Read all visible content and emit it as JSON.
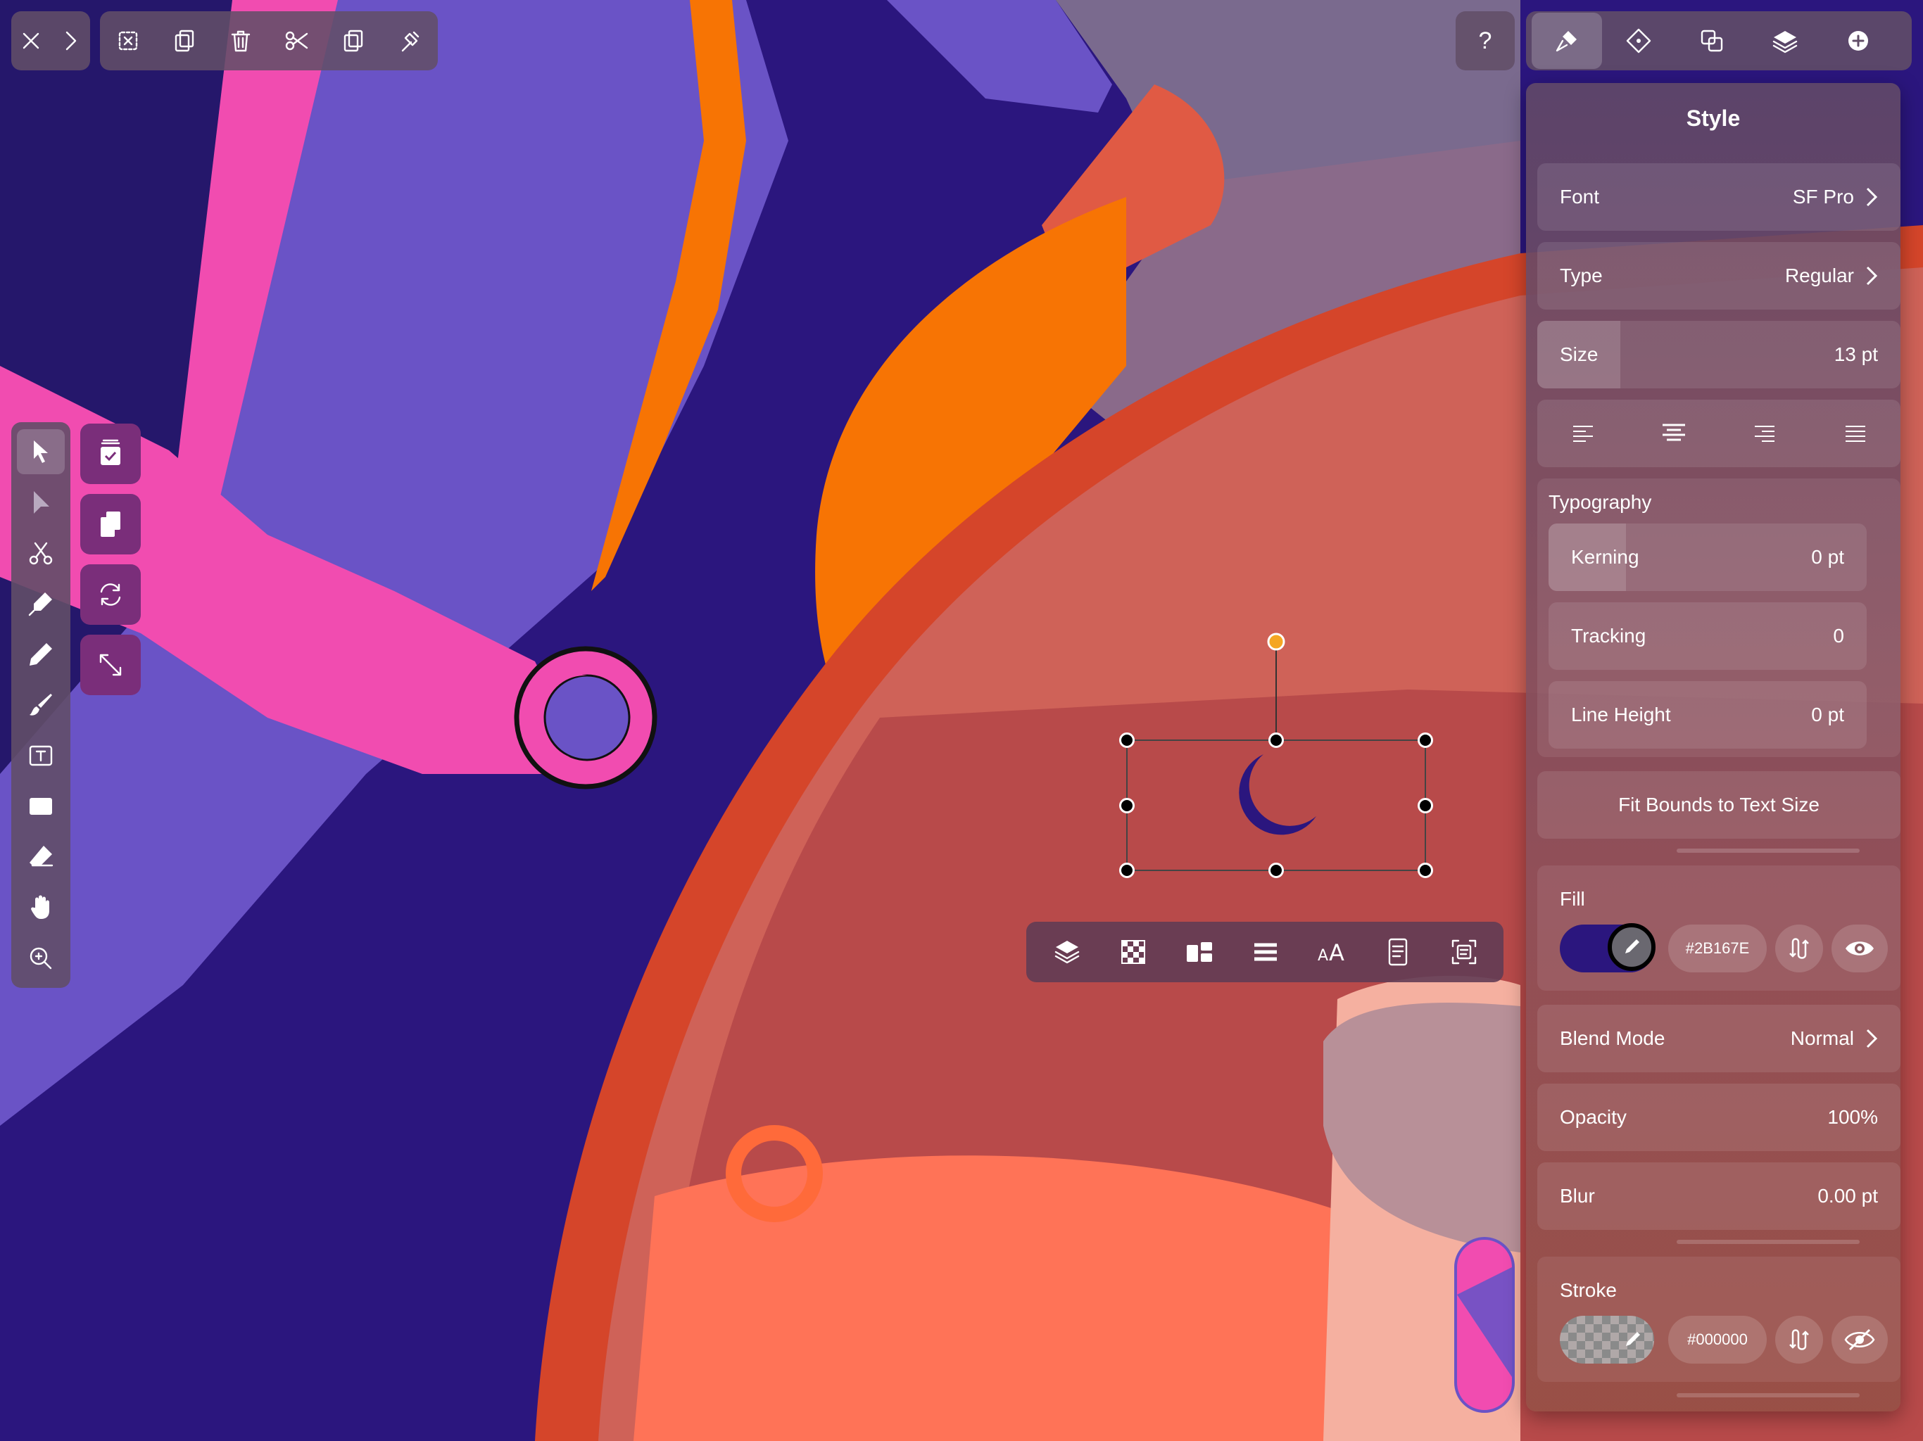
{
  "colors": {
    "accent_purple": "#2B167E",
    "pink": "#F14CB0",
    "orange": "#F77404",
    "violet": "#6A53C6"
  },
  "top_toolbar": {
    "left_group": [
      "close-icon",
      "chevron-right-icon"
    ],
    "edit_group": [
      "deselect-icon",
      "duplicate-icon",
      "trash-icon",
      "scissors-icon",
      "copy-icon",
      "paste-style-icon"
    ],
    "help_label": "?",
    "panel_tabs": [
      "style-brush-icon",
      "diamond-icon",
      "boolean-icon",
      "layers-icon",
      "plus-circle-icon"
    ]
  },
  "style_panel": {
    "title": "Style",
    "font": {
      "label": "Font",
      "value": "SF Pro"
    },
    "type": {
      "label": "Type",
      "value": "Regular"
    },
    "size": {
      "label": "Size",
      "value": "13 pt"
    },
    "alignment": [
      "align-left-icon",
      "align-center-icon",
      "align-right-icon",
      "align-justify-icon"
    ],
    "typography": {
      "heading": "Typography",
      "kerning": {
        "label": "Kerning",
        "value": "0 pt"
      },
      "tracking": {
        "label": "Tracking",
        "value": "0"
      },
      "line_height": {
        "label": "Line Height",
        "value": "0 pt"
      }
    },
    "fit_bounds_label": "Fit Bounds to Text Size",
    "fill": {
      "label": "Fill",
      "hex": "#2B167E",
      "color": "#2B167E"
    },
    "blend_mode": {
      "label": "Blend Mode",
      "value": "Normal"
    },
    "opacity": {
      "label": "Opacity",
      "value": "100%"
    },
    "blur": {
      "label": "Blur",
      "value": "0.00 pt"
    },
    "stroke": {
      "label": "Stroke",
      "hex": "#000000"
    }
  },
  "context_bar": [
    "layers-icon",
    "checker-icon",
    "arrange-icon",
    "menu-icon",
    "text-size-icon",
    "document-icon",
    "fit-frame-icon"
  ],
  "left_tools": [
    "select-arrow-icon",
    "direct-select-icon",
    "scissors-node-icon",
    "pen-icon",
    "pencil-icon",
    "brush-icon",
    "text-tool-icon",
    "rectangle-icon",
    "eraser-icon",
    "hand-icon",
    "zoom-icon"
  ],
  "quick_actions": [
    "select-all-icon",
    "duplicate-icon",
    "rotate-icon",
    "resize-icon"
  ]
}
